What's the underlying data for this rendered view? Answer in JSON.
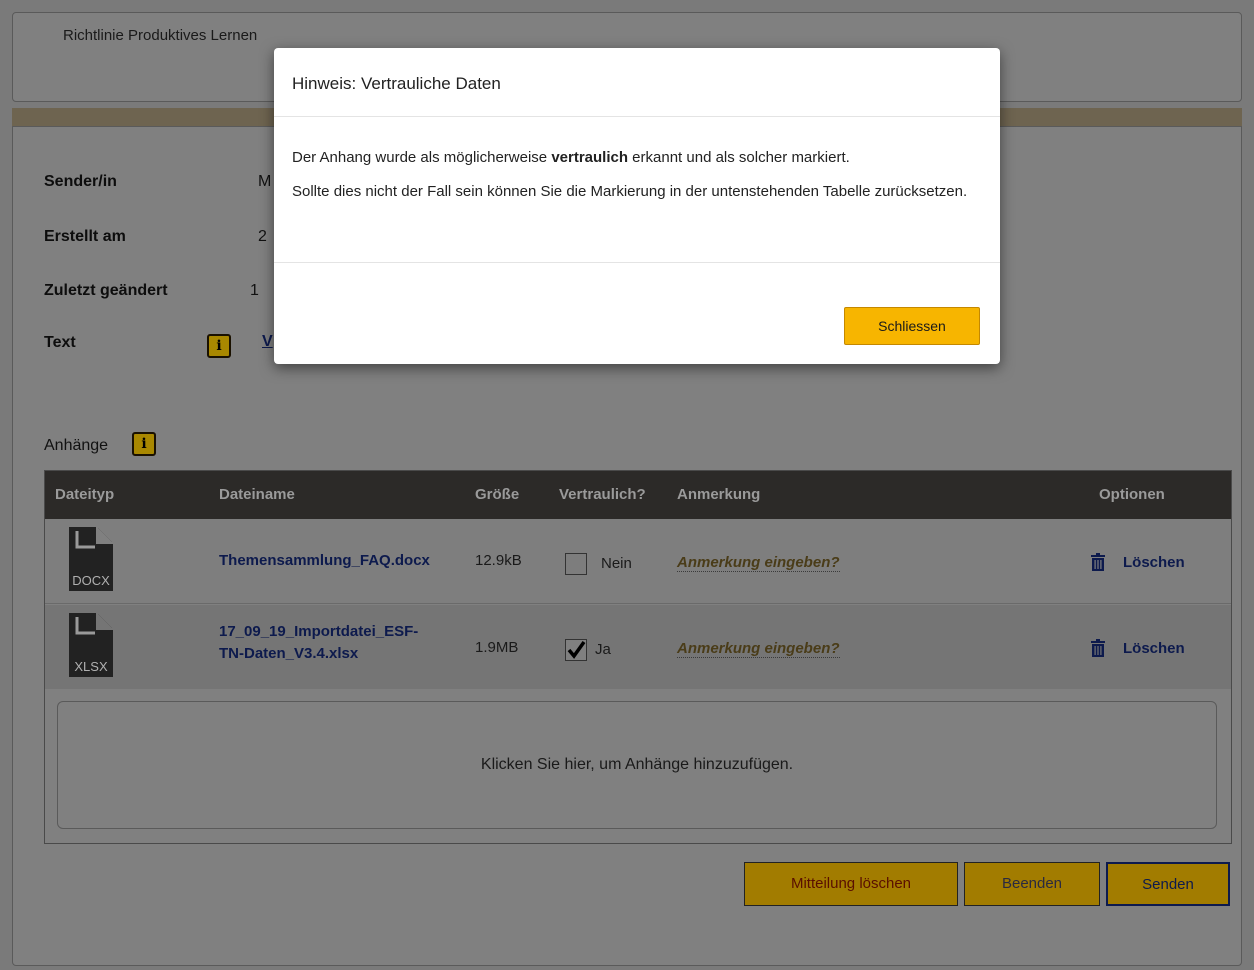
{
  "header": {
    "title": "Richtlinie Produktives Lernen"
  },
  "fields": {
    "sender_label": "Sender/in",
    "sender_value": "M",
    "created_label": "Erstellt am",
    "created_value": "2",
    "modified_label": "Zuletzt geändert",
    "modified_value": "1",
    "text_label": "Text",
    "text_value": "V"
  },
  "attachments": {
    "label": "Anhänge",
    "columns": {
      "filetype": "Dateityp",
      "filename": "Dateiname",
      "size": "Größe",
      "confidential": "Vertraulich?",
      "note": "Anmerkung",
      "options": "Optionen"
    },
    "rows": [
      {
        "filetype": "DOCX",
        "filename_line1": "Themensammlung_FAQ.docx",
        "filename_line2": "",
        "size": "12.9kB",
        "confidential": false,
        "confidential_label": "Nein",
        "note": "Anmerkung eingeben?",
        "delete_label": "Löschen"
      },
      {
        "filetype": "XLSX",
        "filename_line1": "17_09_19_Importdatei_ESF-",
        "filename_line2": "TN-Daten_V3.4.xlsx",
        "size": "1.9MB",
        "confidential": true,
        "confidential_label": "Ja",
        "note": "Anmerkung eingeben?",
        "delete_label": "Löschen"
      }
    ],
    "dropzone_text": "Klicken Sie hier, um Anhänge hinzuzufügen."
  },
  "actions": {
    "delete_message": "Mitteilung löschen",
    "end": "Beenden",
    "send": "Senden"
  },
  "modal": {
    "title": "Hinweis: Vertrauliche Daten",
    "line1_pre": "Der Anhang wurde als möglicherweise ",
    "line1_bold": "vertraulich",
    "line1_post": " erkannt und als solcher markiert.",
    "line2": "Sollte dies nicht der Fall sein können Sie die Markierung in der untenstehenden Tabelle zurücksetzen.",
    "close": "Schliessen"
  },
  "colors": {
    "accent": "#f7b500",
    "table_header": "#2c2a28",
    "link": "#0d1a4d"
  }
}
